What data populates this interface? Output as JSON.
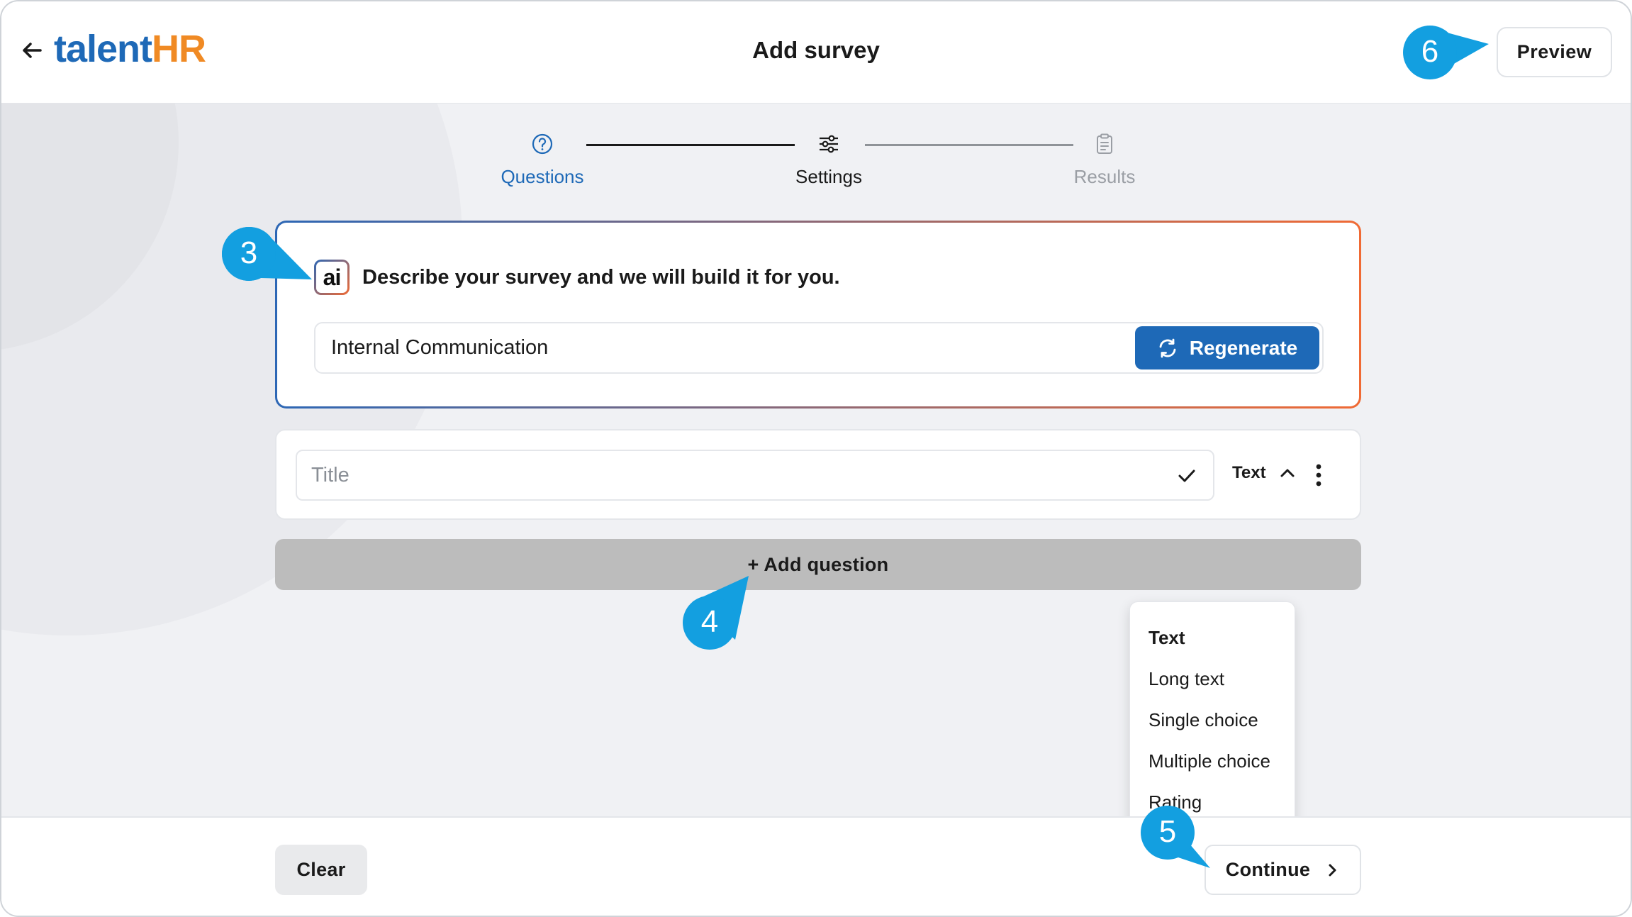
{
  "header": {
    "logo_part1": "talent",
    "logo_part2": "HR",
    "title": "Add survey",
    "preview_label": "Preview"
  },
  "stepper": {
    "steps": [
      {
        "label": "Questions",
        "state": "active"
      },
      {
        "label": "Settings",
        "state": "done"
      },
      {
        "label": "Results",
        "state": "pending"
      }
    ]
  },
  "ai": {
    "badge": "ai",
    "heading": "Describe your survey and we will build it for you.",
    "input_value": "Internal Communication",
    "regenerate_label": "Regenerate"
  },
  "question": {
    "title_placeholder": "Title",
    "type_label": "Text"
  },
  "add_question_label": "+ Add question",
  "type_dropdown": {
    "options": [
      "Text",
      "Long text",
      "Single choice",
      "Multiple choice",
      "Rating"
    ],
    "selected": "Text"
  },
  "footer": {
    "clear_label": "Clear",
    "continue_label": "Continue"
  },
  "callouts": [
    "3",
    "4",
    "5",
    "6"
  ],
  "colors": {
    "brand_blue": "#1e69b7",
    "brand_orange": "#f08a24",
    "callout_blue": "#139fe0",
    "background": "#f0f1f4"
  }
}
